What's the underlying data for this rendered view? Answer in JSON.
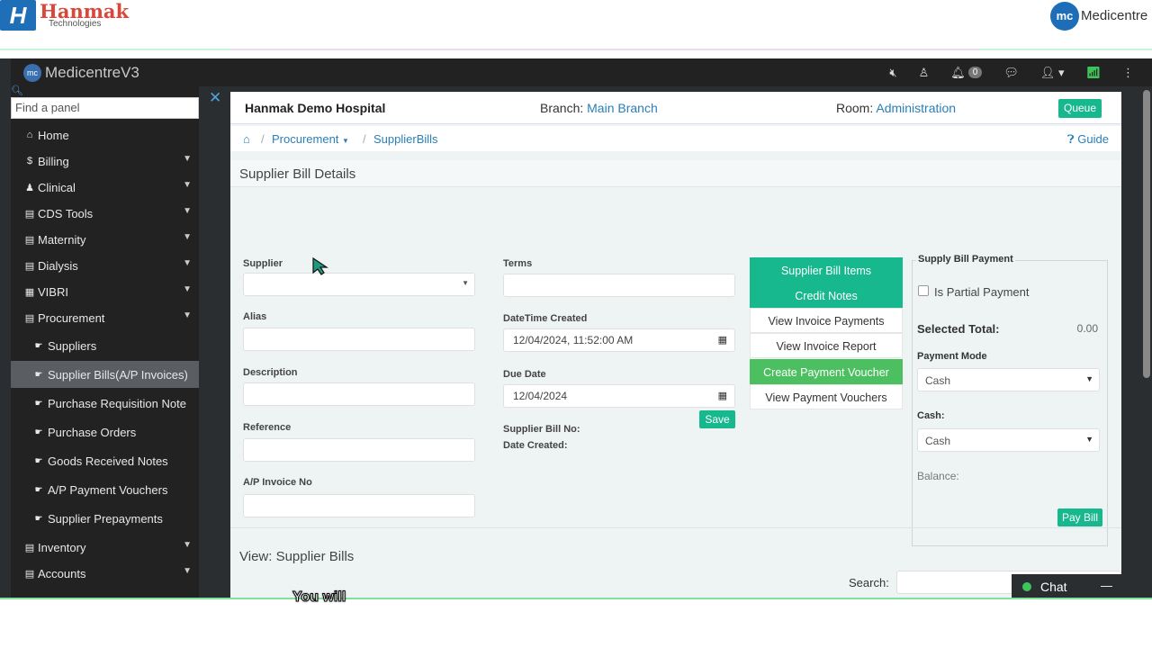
{
  "banner": {
    "brand_name": "Hanmak",
    "brand_sub": "Technologies",
    "brand_logo_glyph": "H",
    "partner_logo_glyph": "mc",
    "partner_name": "Medicentre"
  },
  "navbar": {
    "app_logo_glyph": "mc",
    "app_title": "MedicentreV3",
    "notification_count": "0"
  },
  "sidebar": {
    "search_placeholder": "Find a panel",
    "items": [
      {
        "label": "Home",
        "icon": "home-icon",
        "glyph": "⌂"
      },
      {
        "label": "Billing",
        "icon": "dollar-icon",
        "glyph": "$"
      },
      {
        "label": "Clinical",
        "icon": "user-md-icon",
        "glyph": "♟"
      },
      {
        "label": "CDS Tools",
        "icon": "book-icon",
        "glyph": "▤"
      },
      {
        "label": "Maternity",
        "icon": "book-icon",
        "glyph": "▤"
      },
      {
        "label": "Dialysis",
        "icon": "book-icon",
        "glyph": "▤"
      },
      {
        "label": "VIBRI",
        "icon": "table-icon",
        "glyph": "▦"
      },
      {
        "label": "Procurement",
        "icon": "book-icon",
        "glyph": "▤"
      }
    ],
    "subitems": [
      {
        "label": "Suppliers",
        "glyph": "☛"
      },
      {
        "label": "Supplier Bills(A/P Invoices)",
        "glyph": "☛"
      },
      {
        "label": "Purchase Requisition Note",
        "glyph": "☛"
      },
      {
        "label": "Purchase Orders",
        "glyph": "☛"
      },
      {
        "label": "Goods Received Notes",
        "glyph": "☛"
      },
      {
        "label": "A/P Payment Vouchers",
        "glyph": "☛"
      },
      {
        "label": "Supplier Prepayments",
        "glyph": "☛"
      }
    ],
    "bottom_items": [
      {
        "label": "Inventory",
        "icon": "book-icon",
        "glyph": "▤"
      },
      {
        "label": "Accounts",
        "icon": "book-icon",
        "glyph": "▤"
      }
    ]
  },
  "header": {
    "hospital": "Hanmak Demo Hospital",
    "branch_label": "Branch:",
    "branch_value": "Main Branch",
    "room_label": "Room:",
    "room_value": "Administration",
    "queue_label": "Queue"
  },
  "breadcrumb": {
    "section": "Procurement",
    "current": "SupplierBills",
    "guide": "Guide"
  },
  "form": {
    "title": "Supplier Bill Details",
    "supplier_label": "Supplier",
    "supplier_value": "",
    "alias_label": "Alias",
    "description_label": "Description",
    "reference_label": "Reference",
    "ap_invoice_label": "A/P Invoice No",
    "terms_label": "Terms",
    "datetime_label": "DateTime Created",
    "datetime_value": "12/04/2024, 11:52:00 AM",
    "due_label": "Due Date",
    "due_value": "12/04/2024",
    "bill_no_label": "Supplier Bill No:",
    "date_created_label": "Date Created:",
    "save_label": "Save"
  },
  "tabs": [
    "Supplier Bill Items",
    "Credit Notes",
    "View Invoice Payments",
    "View Invoice Report",
    "Create Payment Voucher",
    "View Payment Vouchers"
  ],
  "payment": {
    "legend": "Supply Bill Payment",
    "partial_label": "Is Partial Payment",
    "selected_total_label": "Selected Total:",
    "selected_total_value": "0.00",
    "mode_label": "Payment Mode",
    "mode_value": "Cash",
    "cash_label": "Cash:",
    "cash_value": "Cash",
    "balance_label": "Balance:",
    "pay_label": "Pay Bill"
  },
  "list": {
    "title": "View: Supplier Bills",
    "search_label": "Search:"
  },
  "chat": {
    "label": "Chat",
    "minimize": "—"
  },
  "caption": "You will",
  "colors": {
    "accent": "#18b88e",
    "green": "#4cc060",
    "link": "#2a7fb5",
    "dark": "#222222"
  }
}
